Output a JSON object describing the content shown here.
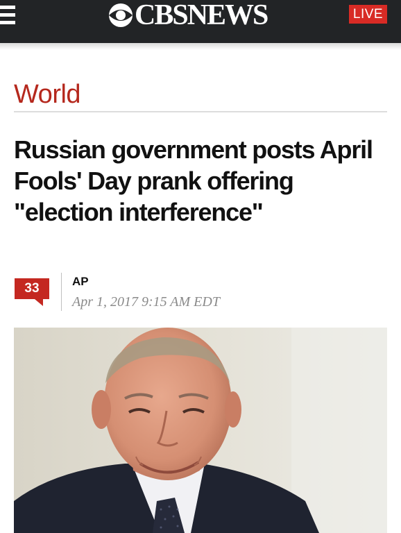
{
  "header": {
    "brand": "CBSNEWS",
    "live_label": "LIVE",
    "menu_icon": "hamburger-menu-icon",
    "logo_icon": "cbs-eye-icon",
    "colors": {
      "bar": "#222426",
      "live": "#d82b25"
    }
  },
  "section": {
    "label": "World",
    "color": "#b5281d"
  },
  "article": {
    "headline": "Russian government posts April Fools' Day prank offering \"election interference\"",
    "comment_count": "33",
    "author": "AP",
    "timestamp": "Apr 1, 2017 9:15 AM EDT"
  },
  "media": {
    "image": "photo of smiling man in dark suit and tie"
  }
}
